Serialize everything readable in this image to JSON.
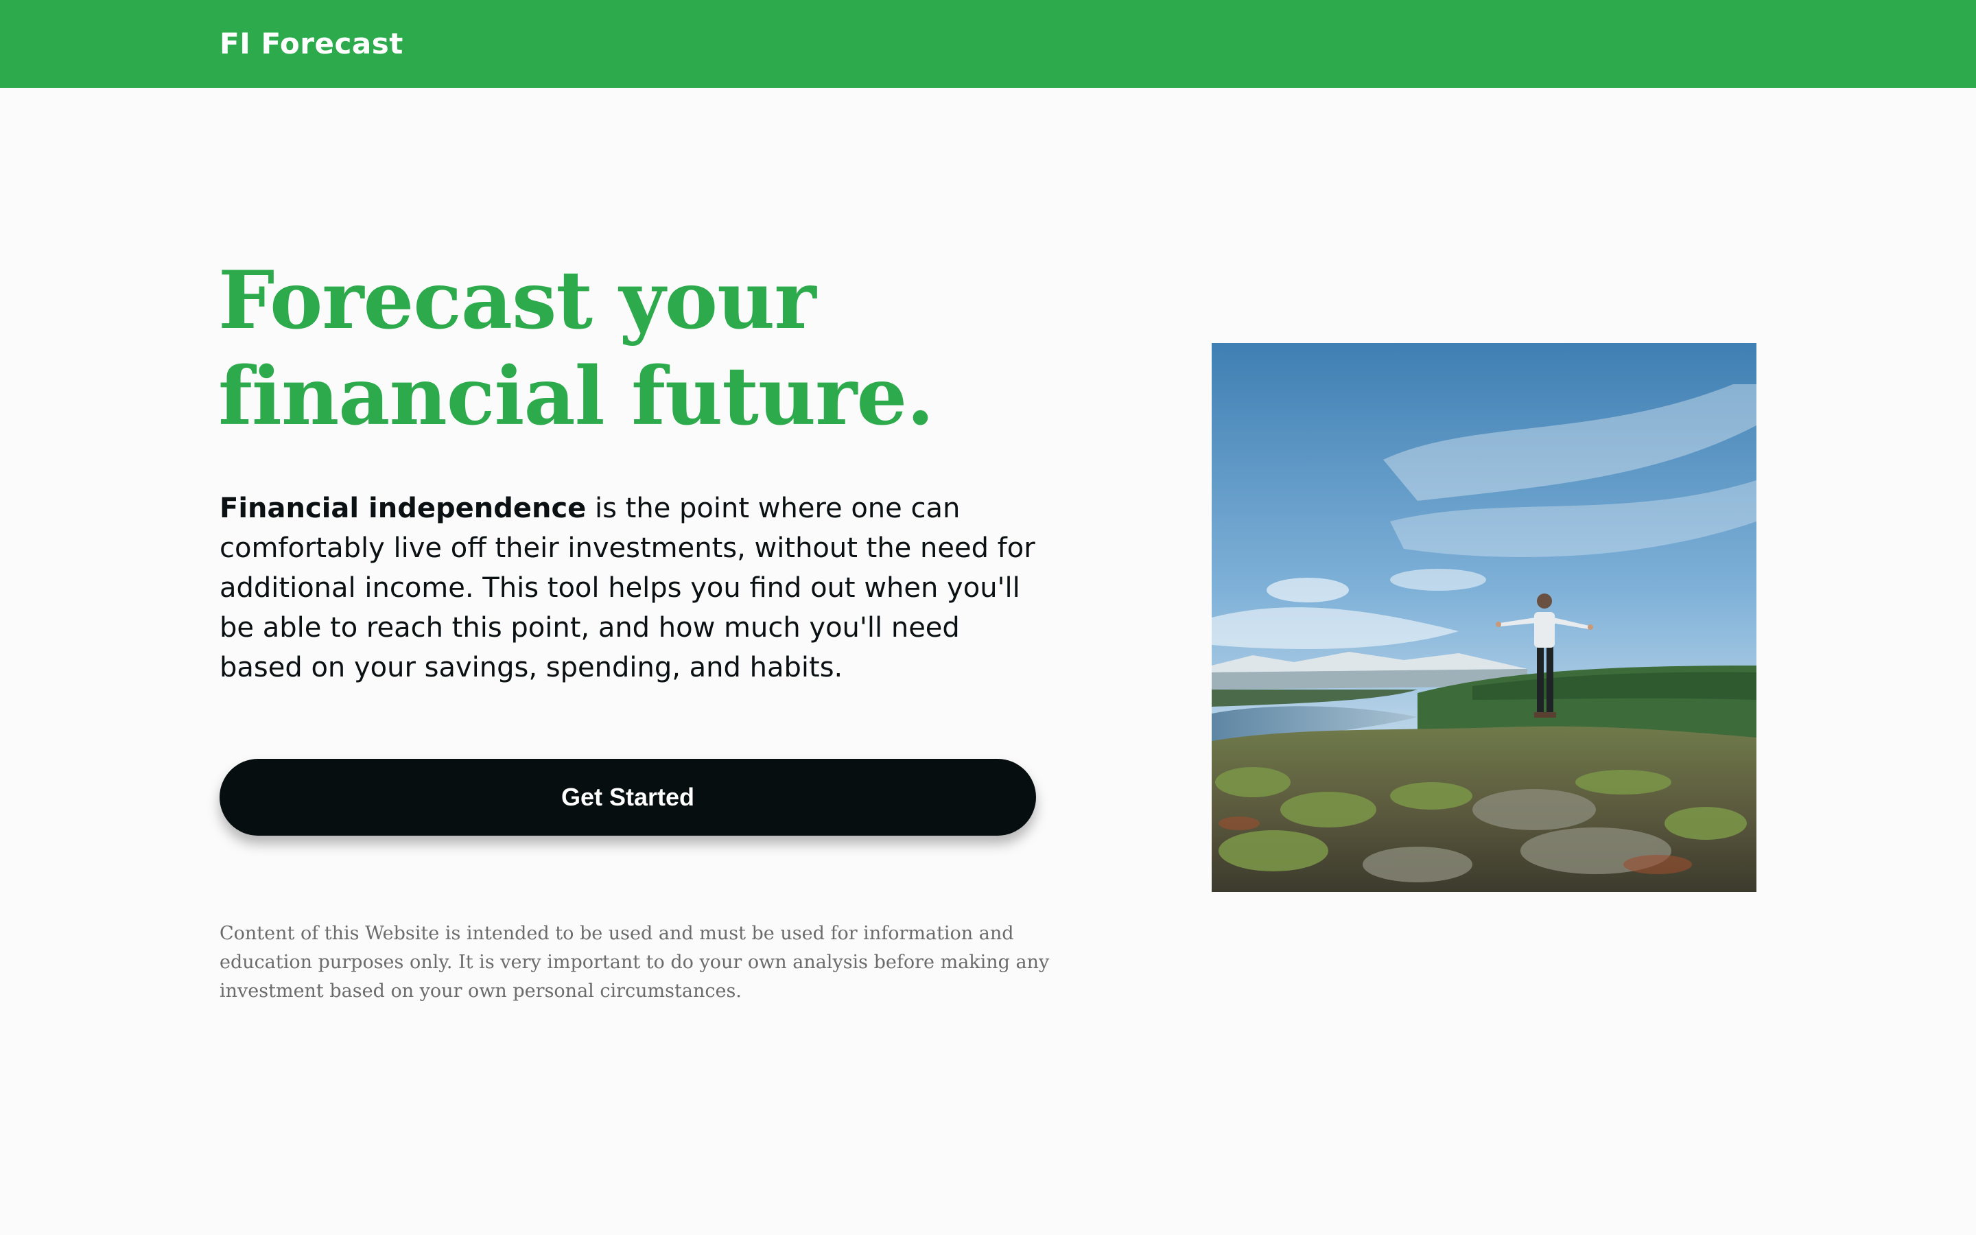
{
  "header": {
    "brand": "FI Forecast",
    "background_color": "#2caa4c"
  },
  "hero": {
    "title_line1": "Forecast your",
    "title_line2": "financial future.",
    "intro_bold": "Financial independence",
    "intro_rest": " is the point where one can comfortably live off their investments, without the need for additional income. This tool helps you find out when you'll be able to reach this point, and how much you'll need based on your savings, spending, and habits.",
    "cta_label": "Get Started",
    "disclaimer": "Content of this Website is intended to be used and must be used for information and education purposes only. It is very important to do your own analysis before making any investment based on your own personal circumstances."
  },
  "image": {
    "alt": "Person standing on a hilltop with arms outstretched overlooking a lake and mountains"
  },
  "colors": {
    "accent": "#2caa4c",
    "button": "#060e0f",
    "text": "#0b1012",
    "muted": "#6b6b6b",
    "page_background": "#fbfbfb"
  }
}
